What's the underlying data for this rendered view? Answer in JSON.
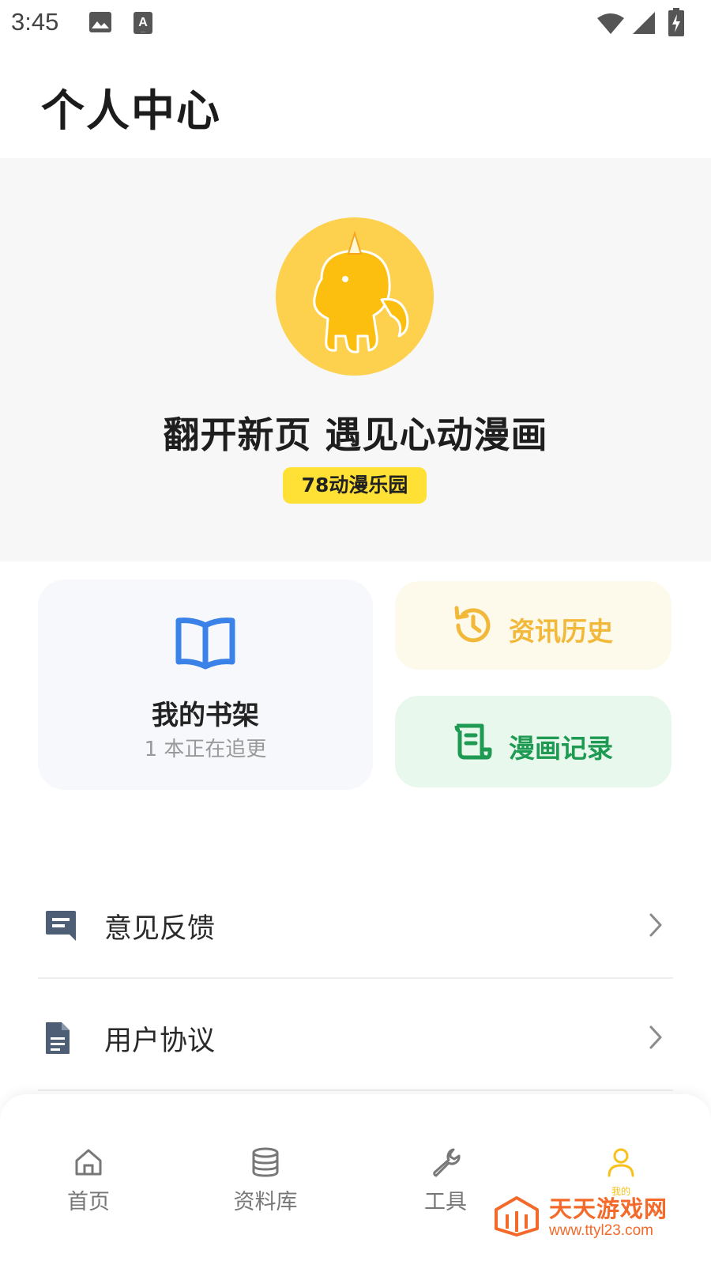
{
  "status_bar": {
    "time": "3:45",
    "icons": [
      "image-icon",
      "text-a-icon",
      "wifi-icon",
      "signal-icon",
      "battery-charging-icon"
    ]
  },
  "page": {
    "title": "个人中心"
  },
  "profile": {
    "avatar_icon": "unicorn-avatar-icon",
    "slogan": "翻开新页 遇见心动漫画",
    "badge": "78动漫乐园"
  },
  "cards": {
    "shelf": {
      "title": "我的书架",
      "subtitle": "1 本正在追更",
      "icon": "book-icon",
      "color": "#3b82e8"
    },
    "history": {
      "label": "资讯历史",
      "icon": "history-clock-icon",
      "color": "#f2b83a"
    },
    "record": {
      "label": "漫画记录",
      "icon": "scroll-icon",
      "color": "#1e9a52"
    }
  },
  "menu": [
    {
      "label": "意见反馈",
      "icon": "feedback-message-icon"
    },
    {
      "label": "用户协议",
      "icon": "document-icon"
    }
  ],
  "bottom_nav": [
    {
      "label": "首页",
      "icon": "home-icon",
      "active": false
    },
    {
      "label": "资料库",
      "icon": "database-icon",
      "active": false
    },
    {
      "label": "工具",
      "icon": "wrench-icon",
      "active": false
    },
    {
      "label": "我的",
      "icon": "user-icon",
      "active": true
    }
  ],
  "colors": {
    "accent": "#f8c01a",
    "badge_bg": "#ffe034",
    "avatar_bg": "#fdd04d"
  },
  "watermark": {
    "name": "天天游戏网",
    "url": "www.ttyl23.com"
  }
}
